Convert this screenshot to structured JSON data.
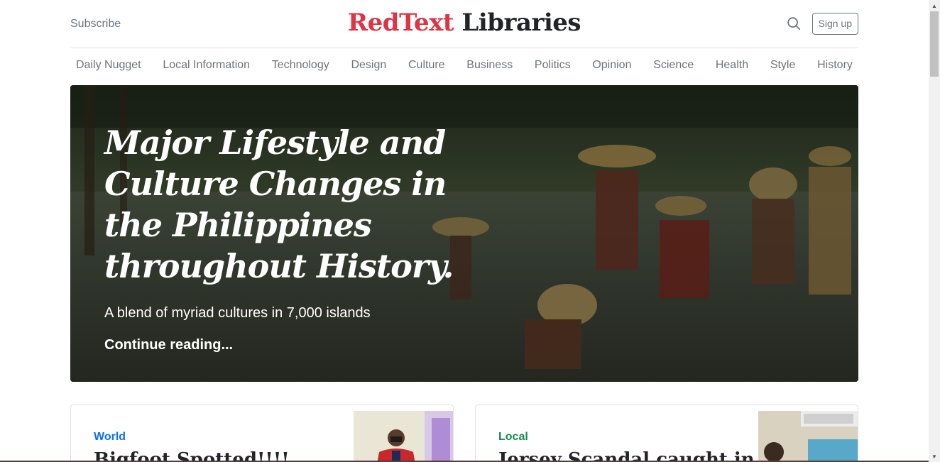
{
  "header": {
    "subscribe_label": "Subscribe",
    "brand_red": "RedText",
    "brand_dark": " Libraries",
    "signup_label": "Sign up",
    "search_icon": "search-icon"
  },
  "nav": {
    "items": [
      "Daily Nugget",
      "Local Information",
      "Technology",
      "Design",
      "Culture",
      "Business",
      "Politics",
      "Opinion",
      "Science",
      "Health",
      "Style",
      "History"
    ]
  },
  "hero": {
    "title": "Major Lifestyle and Culture Changes in the Philippines throughout History.",
    "lead": "A blend of myriad cultures in 7,000 islands",
    "link": "Continue reading..."
  },
  "cards": [
    {
      "category": "World",
      "category_color": "#0d6efd",
      "title": "Bigfoot Spotted!!!!"
    },
    {
      "category": "Local",
      "category_color": "#198754",
      "title": "Jersey Scandal caught in"
    }
  ],
  "colors": {
    "brand_red": "#dc3545",
    "text_dark": "#212529",
    "muted": "#6c757d"
  }
}
